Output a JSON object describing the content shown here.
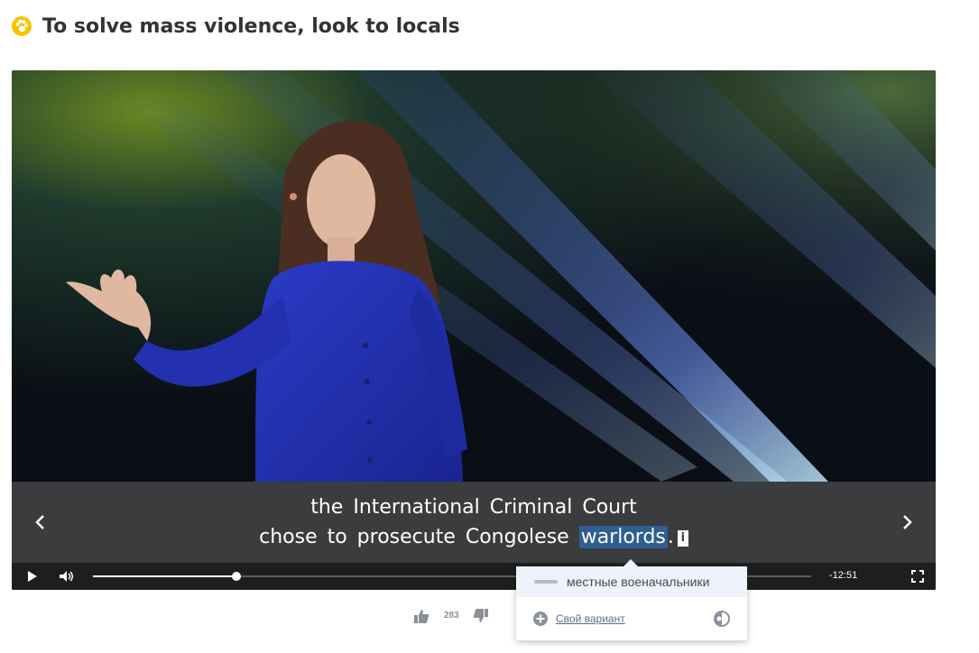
{
  "page": {
    "title": "To solve mass violence, look to locals",
    "logo_icon": "paw-icon",
    "accent_color": "#f5c400"
  },
  "player": {
    "subtitle_line1": "the International Criminal Court",
    "subtitle_line2_before": "chose to prosecute Congolese",
    "subtitle_highlight": "warlords",
    "subtitle_after": ".",
    "info_mark": "i",
    "time_remaining": "-12:51",
    "progress_percent": 20,
    "highlight_color": "#2f5e90"
  },
  "translation_popup": {
    "translation": "местные военачальники",
    "own_variant_label": "Свой вариант"
  },
  "likes": {
    "count": "283"
  }
}
